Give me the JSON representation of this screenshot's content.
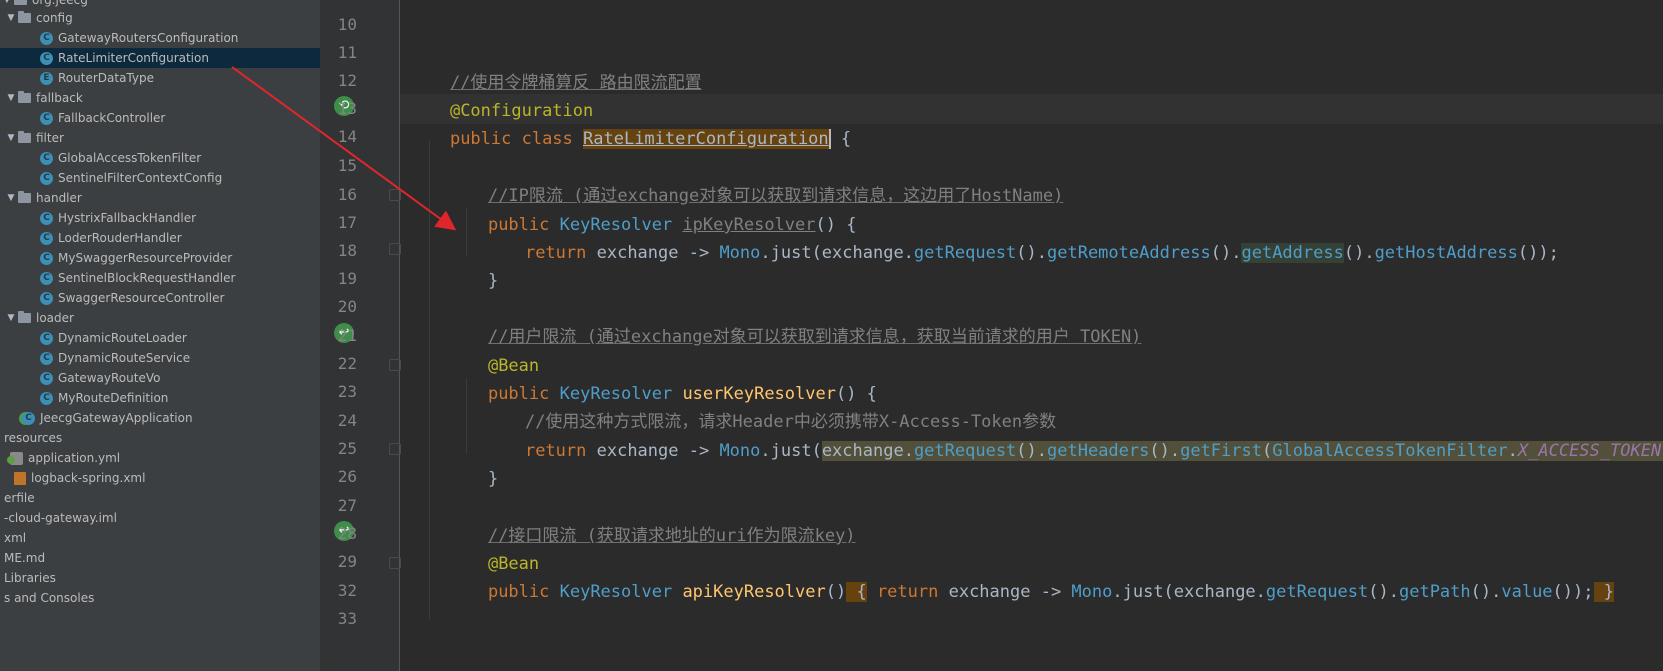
{
  "tree": {
    "items": [
      {
        "label": "org.jeecg",
        "kind": "package",
        "expanded": true
      },
      {
        "label": "config",
        "kind": "folder",
        "expanded": true
      },
      {
        "label": "GatewayRoutersConfiguration",
        "kind": "class"
      },
      {
        "label": "RateLimiterConfiguration",
        "kind": "class",
        "selected": true
      },
      {
        "label": "RouterDataType",
        "kind": "enum"
      },
      {
        "label": "fallback",
        "kind": "folder",
        "expanded": true
      },
      {
        "label": "FallbackController",
        "kind": "class"
      },
      {
        "label": "filter",
        "kind": "folder",
        "expanded": true
      },
      {
        "label": "GlobalAccessTokenFilter",
        "kind": "class"
      },
      {
        "label": "SentinelFilterContextConfig",
        "kind": "class"
      },
      {
        "label": "handler",
        "kind": "folder",
        "expanded": true
      },
      {
        "label": "HystrixFallbackHandler",
        "kind": "class"
      },
      {
        "label": "LoderRouderHandler",
        "kind": "class"
      },
      {
        "label": "MySwaggerResourceProvider",
        "kind": "class"
      },
      {
        "label": "SentinelBlockRequestHandler",
        "kind": "class"
      },
      {
        "label": "SwaggerResourceController",
        "kind": "class"
      },
      {
        "label": "loader",
        "kind": "folder",
        "expanded": true
      },
      {
        "label": "DynamicRouteLoader",
        "kind": "class"
      },
      {
        "label": "DynamicRouteService",
        "kind": "class"
      },
      {
        "label": "GatewayRouteVo",
        "kind": "class"
      },
      {
        "label": "MyRouteDefinition",
        "kind": "class"
      },
      {
        "label": "JeecgGatewayApplication",
        "kind": "app"
      },
      {
        "label": "resources",
        "kind": "plain"
      },
      {
        "label": "application.yml",
        "kind": "yml"
      },
      {
        "label": "logback-spring.xml",
        "kind": "xml"
      },
      {
        "label": "erfile",
        "kind": "plain"
      },
      {
        "label": "-cloud-gateway.iml",
        "kind": "plain"
      },
      {
        "label": "xml",
        "kind": "plain"
      },
      {
        "label": "ME.md",
        "kind": "plain"
      },
      {
        "label": "Libraries",
        "kind": "plain"
      },
      {
        "label": "s and Consoles",
        "kind": "plain"
      }
    ]
  },
  "editor": {
    "line_numbers": [
      "10",
      "11",
      "12",
      "13",
      "14",
      "15",
      "16",
      "17",
      "18",
      "19",
      "20",
      "21",
      "22",
      "23",
      "24",
      "25",
      "26",
      "27",
      "28",
      "29",
      "32",
      "33"
    ],
    "lines": {
      "l11": "//使用令牌桶算反 路由限流配置",
      "l12": "@Configuration",
      "l13_kw": "public class ",
      "l13_name": "RateLimiterConfiguration",
      "l13_tail": " {",
      "l15": "//IP限流 (通过exchange对象可以获取到请求信息，这边用了HostName)",
      "l16_kw": "public ",
      "l16_type": "KeyResolver ",
      "l16_name": "ipKeyResolver",
      "l16_tail": "() {",
      "l17_kw": "return ",
      "l17_a": "exchange -> ",
      "l17_mono": "Mono",
      "l17_b": ".just(exchange.",
      "l17_m1": "getRequest",
      "l17_c": "().",
      "l17_m2": "getRemoteAddress",
      "l17_d": "().",
      "l17_m3": "getAddress",
      "l17_e": "().",
      "l17_m4": "getHostAddress",
      "l17_f": "());",
      "l18": "}",
      "l20": "//用户限流 (通过exchange对象可以获取到请求信息，获取当前请求的用户 TOKEN)",
      "l21": "@Bean",
      "l22_kw": "public ",
      "l22_type": "KeyResolver ",
      "l22_name": "userKeyResolver",
      "l22_tail": "() {",
      "l23": "//使用这种方式限流，请求Header中必须携带X-Access-Token参数",
      "l24_kw": "return ",
      "l24_a": "exchange -> ",
      "l24_mono": "Mono",
      "l24_b": ".just(",
      "l24_c": "exchange.",
      "l24_m1": "getRequest",
      "l24_d": "().",
      "l24_m2": "getHeaders",
      "l24_e": "().",
      "l24_m3": "getFirst",
      "l24_f": "(",
      "l24_cls": "GlobalAccessTokenFilter",
      "l24_g": ".",
      "l24_field": "X_ACCESS_TOKEN",
      "l24_h": ")",
      "l24_i": ");",
      "l25": "}",
      "l27": "//接口限流 (获取请求地址的uri作为限流key)",
      "l28": "@Bean",
      "l29_kw": "public ",
      "l29_type": "KeyResolver ",
      "l29_name": "apiKeyResolver",
      "l29_a": "()",
      "l29_b": " {",
      "l29_kw2": " return ",
      "l29_c": "exchange -> ",
      "l29_mono": "Mono",
      "l29_d": ".just(exchange.",
      "l29_m1": "getRequest",
      "l29_e": "().",
      "l29_m2": "getPath",
      "l29_f": "().",
      "l29_m3": "value",
      "l29_g": "());",
      "l29_h": " }",
      "l33": "}"
    },
    "gutter_icons": [
      "bean-config-icon",
      "bean-icon",
      "bean-icon"
    ]
  },
  "colors": {
    "editor_bg": "#2b2b2b",
    "tree_bg": "#3c3f41",
    "selection": "#0d293e",
    "keyword": "#cc7832",
    "annotation": "#bbb529",
    "comment": "#808080",
    "arrow": "#e0262b"
  }
}
